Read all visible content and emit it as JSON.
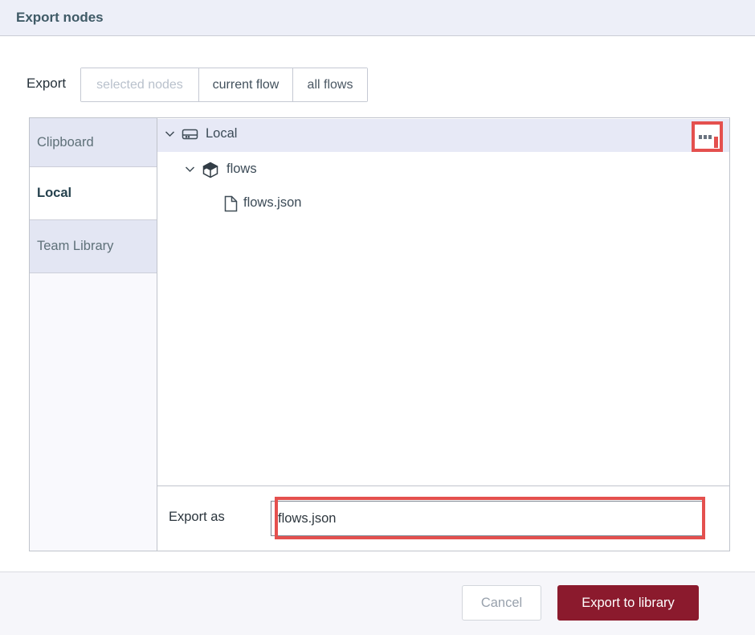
{
  "dialog": {
    "title": "Export nodes"
  },
  "export_options": {
    "label": "Export",
    "buttons": [
      {
        "label": "selected nodes",
        "state": "disabled"
      },
      {
        "label": "current flow",
        "state": "selected"
      },
      {
        "label": "all flows",
        "state": "default"
      }
    ]
  },
  "library": {
    "tabs": [
      {
        "label": "Clipboard",
        "selected": false
      },
      {
        "label": "Local",
        "selected": true
      },
      {
        "label": "Team Library",
        "selected": false
      }
    ],
    "tree": [
      {
        "label": "Local",
        "icon": "hard-drive-icon",
        "expanded": true,
        "depth": 0,
        "highlighted": true
      },
      {
        "label": "flows",
        "icon": "cube-icon",
        "expanded": true,
        "depth": 1
      },
      {
        "label": "flows.json",
        "icon": "file-icon",
        "depth": 2
      }
    ],
    "menu_button": {
      "icon": "ellipsis-icon",
      "annotated": true
    }
  },
  "export_as": {
    "label": "Export as",
    "value": "flows.json",
    "annotated": true
  },
  "actions": {
    "cancel": "Cancel",
    "confirm": "Export to library"
  },
  "annotations": {
    "highlight_color": "#e4504e",
    "targets": [
      "library-menu-button",
      "export-as-input"
    ]
  },
  "colors": {
    "header_bg": "#edeff8",
    "tab_lavender": "#e3e6f3",
    "selected_option_bg": "#dcdfef",
    "tree_row_highlight": "#e7e9f6",
    "confirm_button_bg": "#8b1a2d",
    "title_text": "#3f5a66",
    "annotation_red": "#e4504e"
  }
}
